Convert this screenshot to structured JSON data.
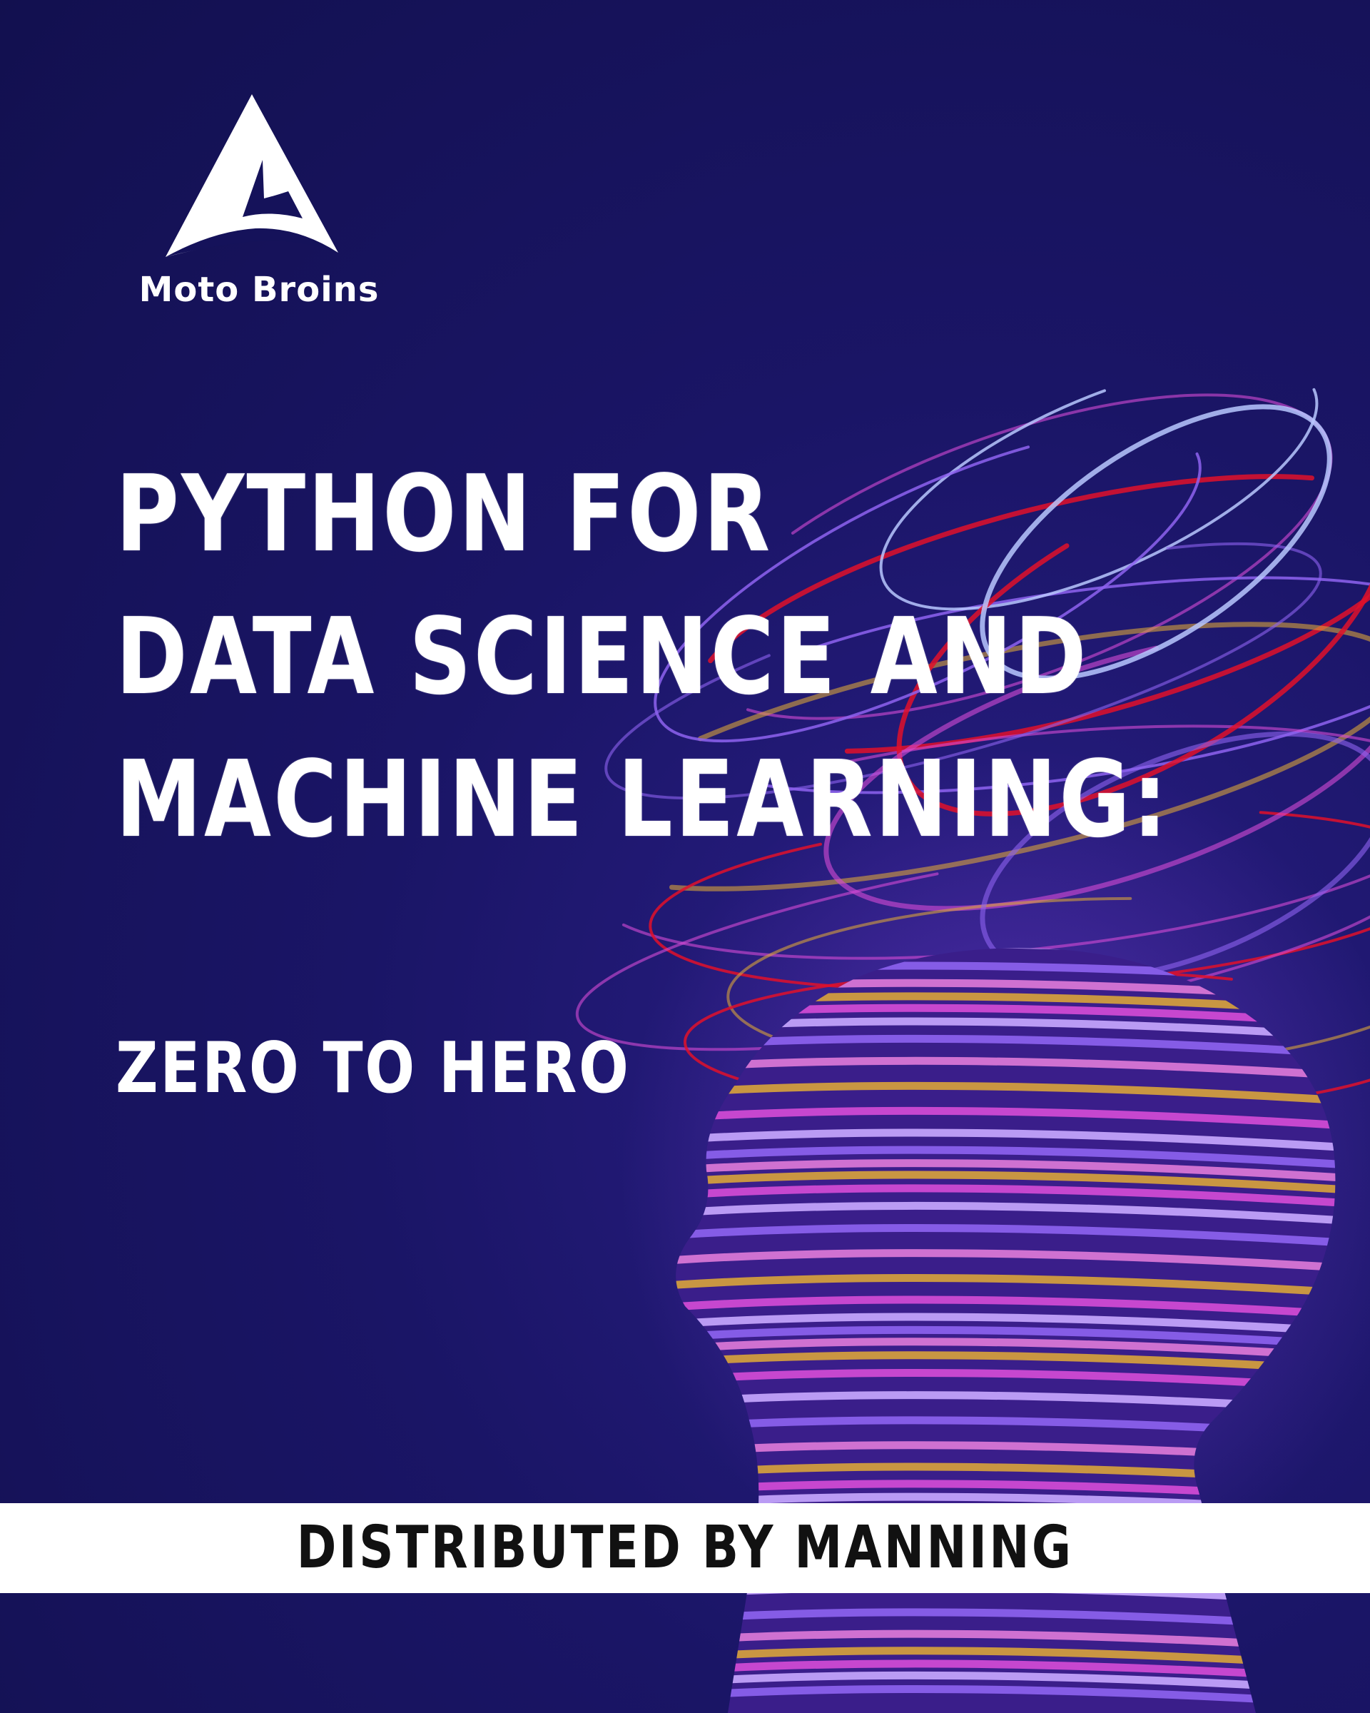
{
  "publisher": {
    "logo_text": "Moto Broins",
    "logo_icon": "triangle-a-logo-icon"
  },
  "title": {
    "lines": [
      "PYTHON FOR",
      "DATA SCIENCE AND",
      "MACHINE LEARNING:"
    ]
  },
  "subtitle": "ZERO TO HERO",
  "banner": {
    "text": "DISTRIBUTED BY MANNING"
  },
  "colors": {
    "background": "#15125a",
    "text": "#ffffff",
    "banner_background": "#ffffff",
    "banner_text": "#111111",
    "accent_red": "#e0102a",
    "accent_magenta": "#d64bd6",
    "accent_violet": "#8e63f0",
    "accent_gold": "#d9a33a"
  }
}
